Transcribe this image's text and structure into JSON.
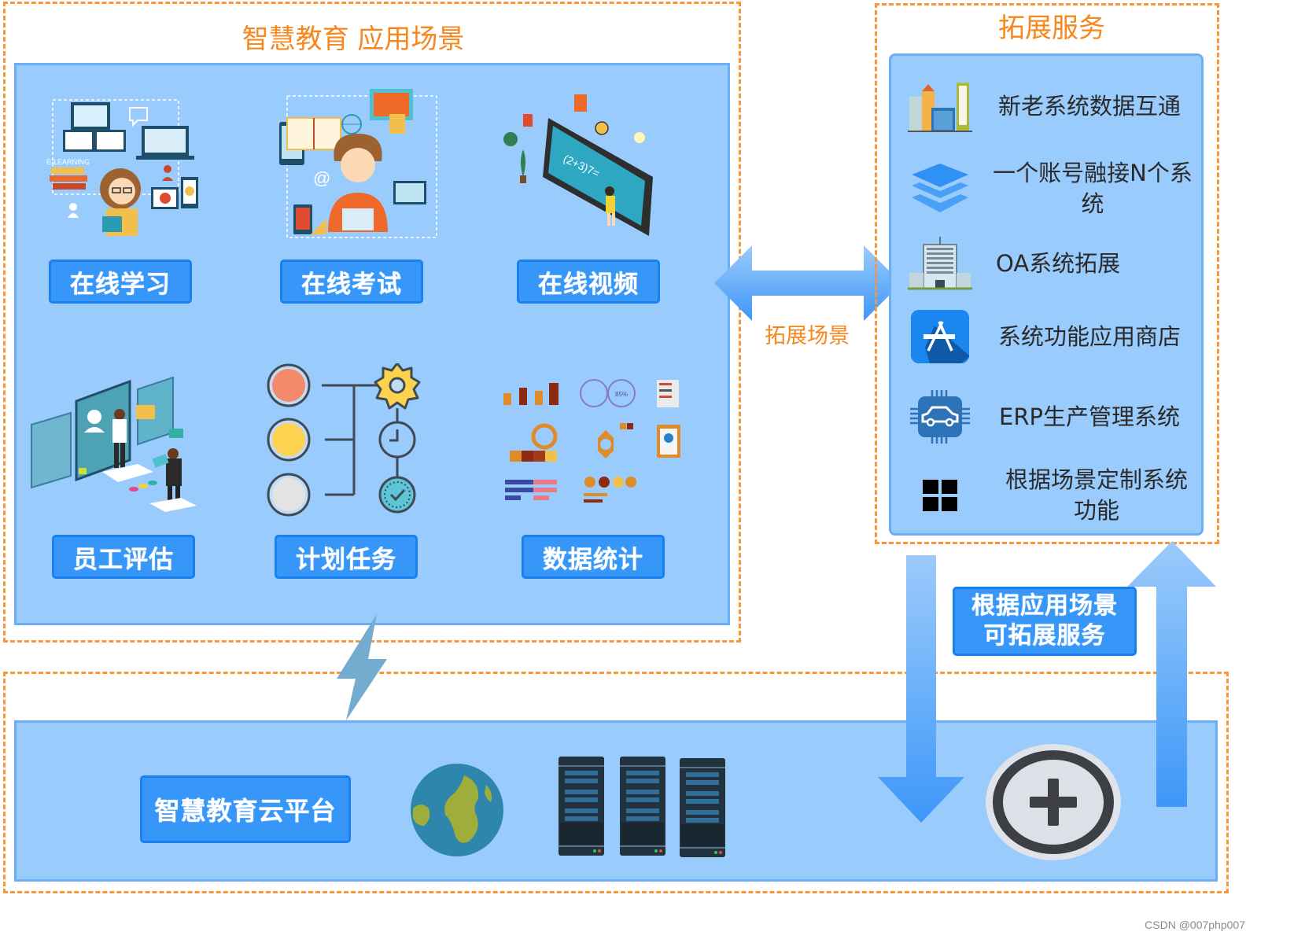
{
  "scenarios": {
    "title": "智慧教育 应用场景",
    "items": [
      {
        "label": "在线学习",
        "icon": "e-learning-illustration"
      },
      {
        "label": "在线考试",
        "icon": "online-exam-illustration"
      },
      {
        "label": "在线视频",
        "icon": "online-video-illustration"
      },
      {
        "label": "员工评估",
        "icon": "employee-evaluation-illustration"
      },
      {
        "label": "计划任务",
        "icon": "plan-task-illustration"
      },
      {
        "label": "数据统计",
        "icon": "data-statistics-illustration"
      }
    ]
  },
  "connector": {
    "label": "拓展场景"
  },
  "services": {
    "title": "拓展服务",
    "items": [
      {
        "label": "新老系统数据互通",
        "icon": "buildings-icon"
      },
      {
        "label": "一个账号融接N个系统",
        "icon": "layers-icon"
      },
      {
        "label": "OA系统拓展",
        "icon": "office-building-icon"
      },
      {
        "label": "系统功能应用商店",
        "icon": "app-store-icon"
      },
      {
        "label": "ERP生产管理系统",
        "icon": "car-chip-icon"
      },
      {
        "label": "根据场景定制系统功能",
        "icon": "grid-icon"
      }
    ]
  },
  "expand_note": {
    "line1": "根据应用场景",
    "line2": "可拓展服务"
  },
  "platform": {
    "label": "智慧教育云平台"
  },
  "watermark": "CSDN @007php007",
  "colors": {
    "accent_orange": "#f7963a",
    "panel_blue": "#99cbfc",
    "button_blue": "#3797f9"
  }
}
